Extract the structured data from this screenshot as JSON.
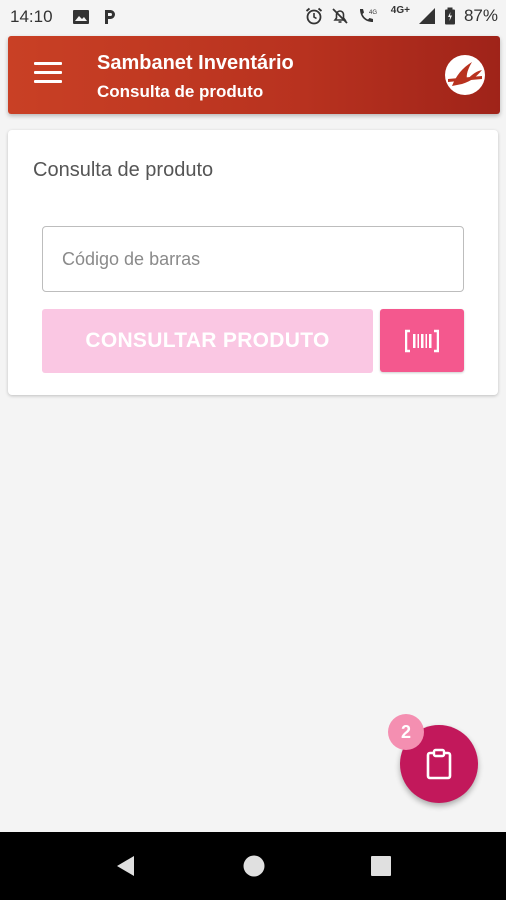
{
  "status_bar": {
    "time": "14:10",
    "battery": "87%",
    "icons": [
      "image-icon",
      "parking-icon",
      "alarm-icon",
      "mute-icon",
      "call-4g-icon",
      "signal-icon",
      "battery-icon"
    ],
    "network_label": "4G+"
  },
  "appbar": {
    "title": "Sambanet Inventário",
    "subtitle": "Consulta de produto",
    "menu_icon": "hamburger-menu-icon",
    "logo": "brand-logo"
  },
  "card": {
    "title": "Consulta de produto",
    "barcode_input": {
      "value": "",
      "placeholder": "Código de barras"
    },
    "consult_button": "CONSULTAR PRODUTO",
    "scan_button_icon": "barcode-scan-icon"
  },
  "fab": {
    "icon": "clipboard-icon",
    "badge_count": "2"
  },
  "colors": {
    "appbar_start": "#c94025",
    "appbar_end": "#9f2319",
    "consult_button_disabled": "#fac7e3",
    "scan_button": "#f4588e",
    "fab": "#c2185b",
    "badge": "#f48fb1"
  },
  "navbar": {
    "icons": [
      "back-icon",
      "home-icon",
      "recents-icon"
    ]
  }
}
